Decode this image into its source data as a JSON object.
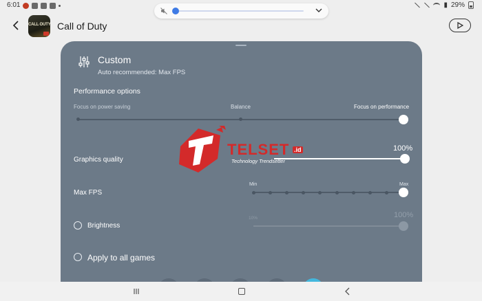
{
  "status_bar": {
    "time": "6:01",
    "battery": "29%"
  },
  "volume": {
    "muted": true,
    "level": 0
  },
  "header": {
    "game_title": "Call of Duty",
    "game_icon_text": "CALL·DUTY"
  },
  "panel": {
    "mode_title": "Custom",
    "mode_subtitle": "Auto recommended: Max FPS",
    "performance": {
      "title": "Performance options",
      "labels": [
        "Focus on power saving",
        "Balance",
        "Focus on performance"
      ],
      "selected_index": 2,
      "stops": 3
    },
    "graphics_quality": {
      "label": "Graphics quality",
      "value_text": "100%",
      "value_percent": 100
    },
    "max_fps": {
      "label": "Max FPS",
      "min_label": "Min",
      "max_label": "Max",
      "stops": 10,
      "selected_index": 9
    },
    "brightness": {
      "label": "Brightness",
      "checked": false,
      "min_label": "10%",
      "value_text": "100%",
      "value_percent": 100
    },
    "apply_all": {
      "label": "Apply to all games",
      "checked": false
    }
  },
  "watermark": {
    "brand": "TELSET",
    "domain": ".id",
    "tagline": "Technology Trendsetter"
  },
  "colors": {
    "panel": "#6c7a88",
    "accent": "#3f7be5",
    "watermark": "#d32a2a"
  }
}
